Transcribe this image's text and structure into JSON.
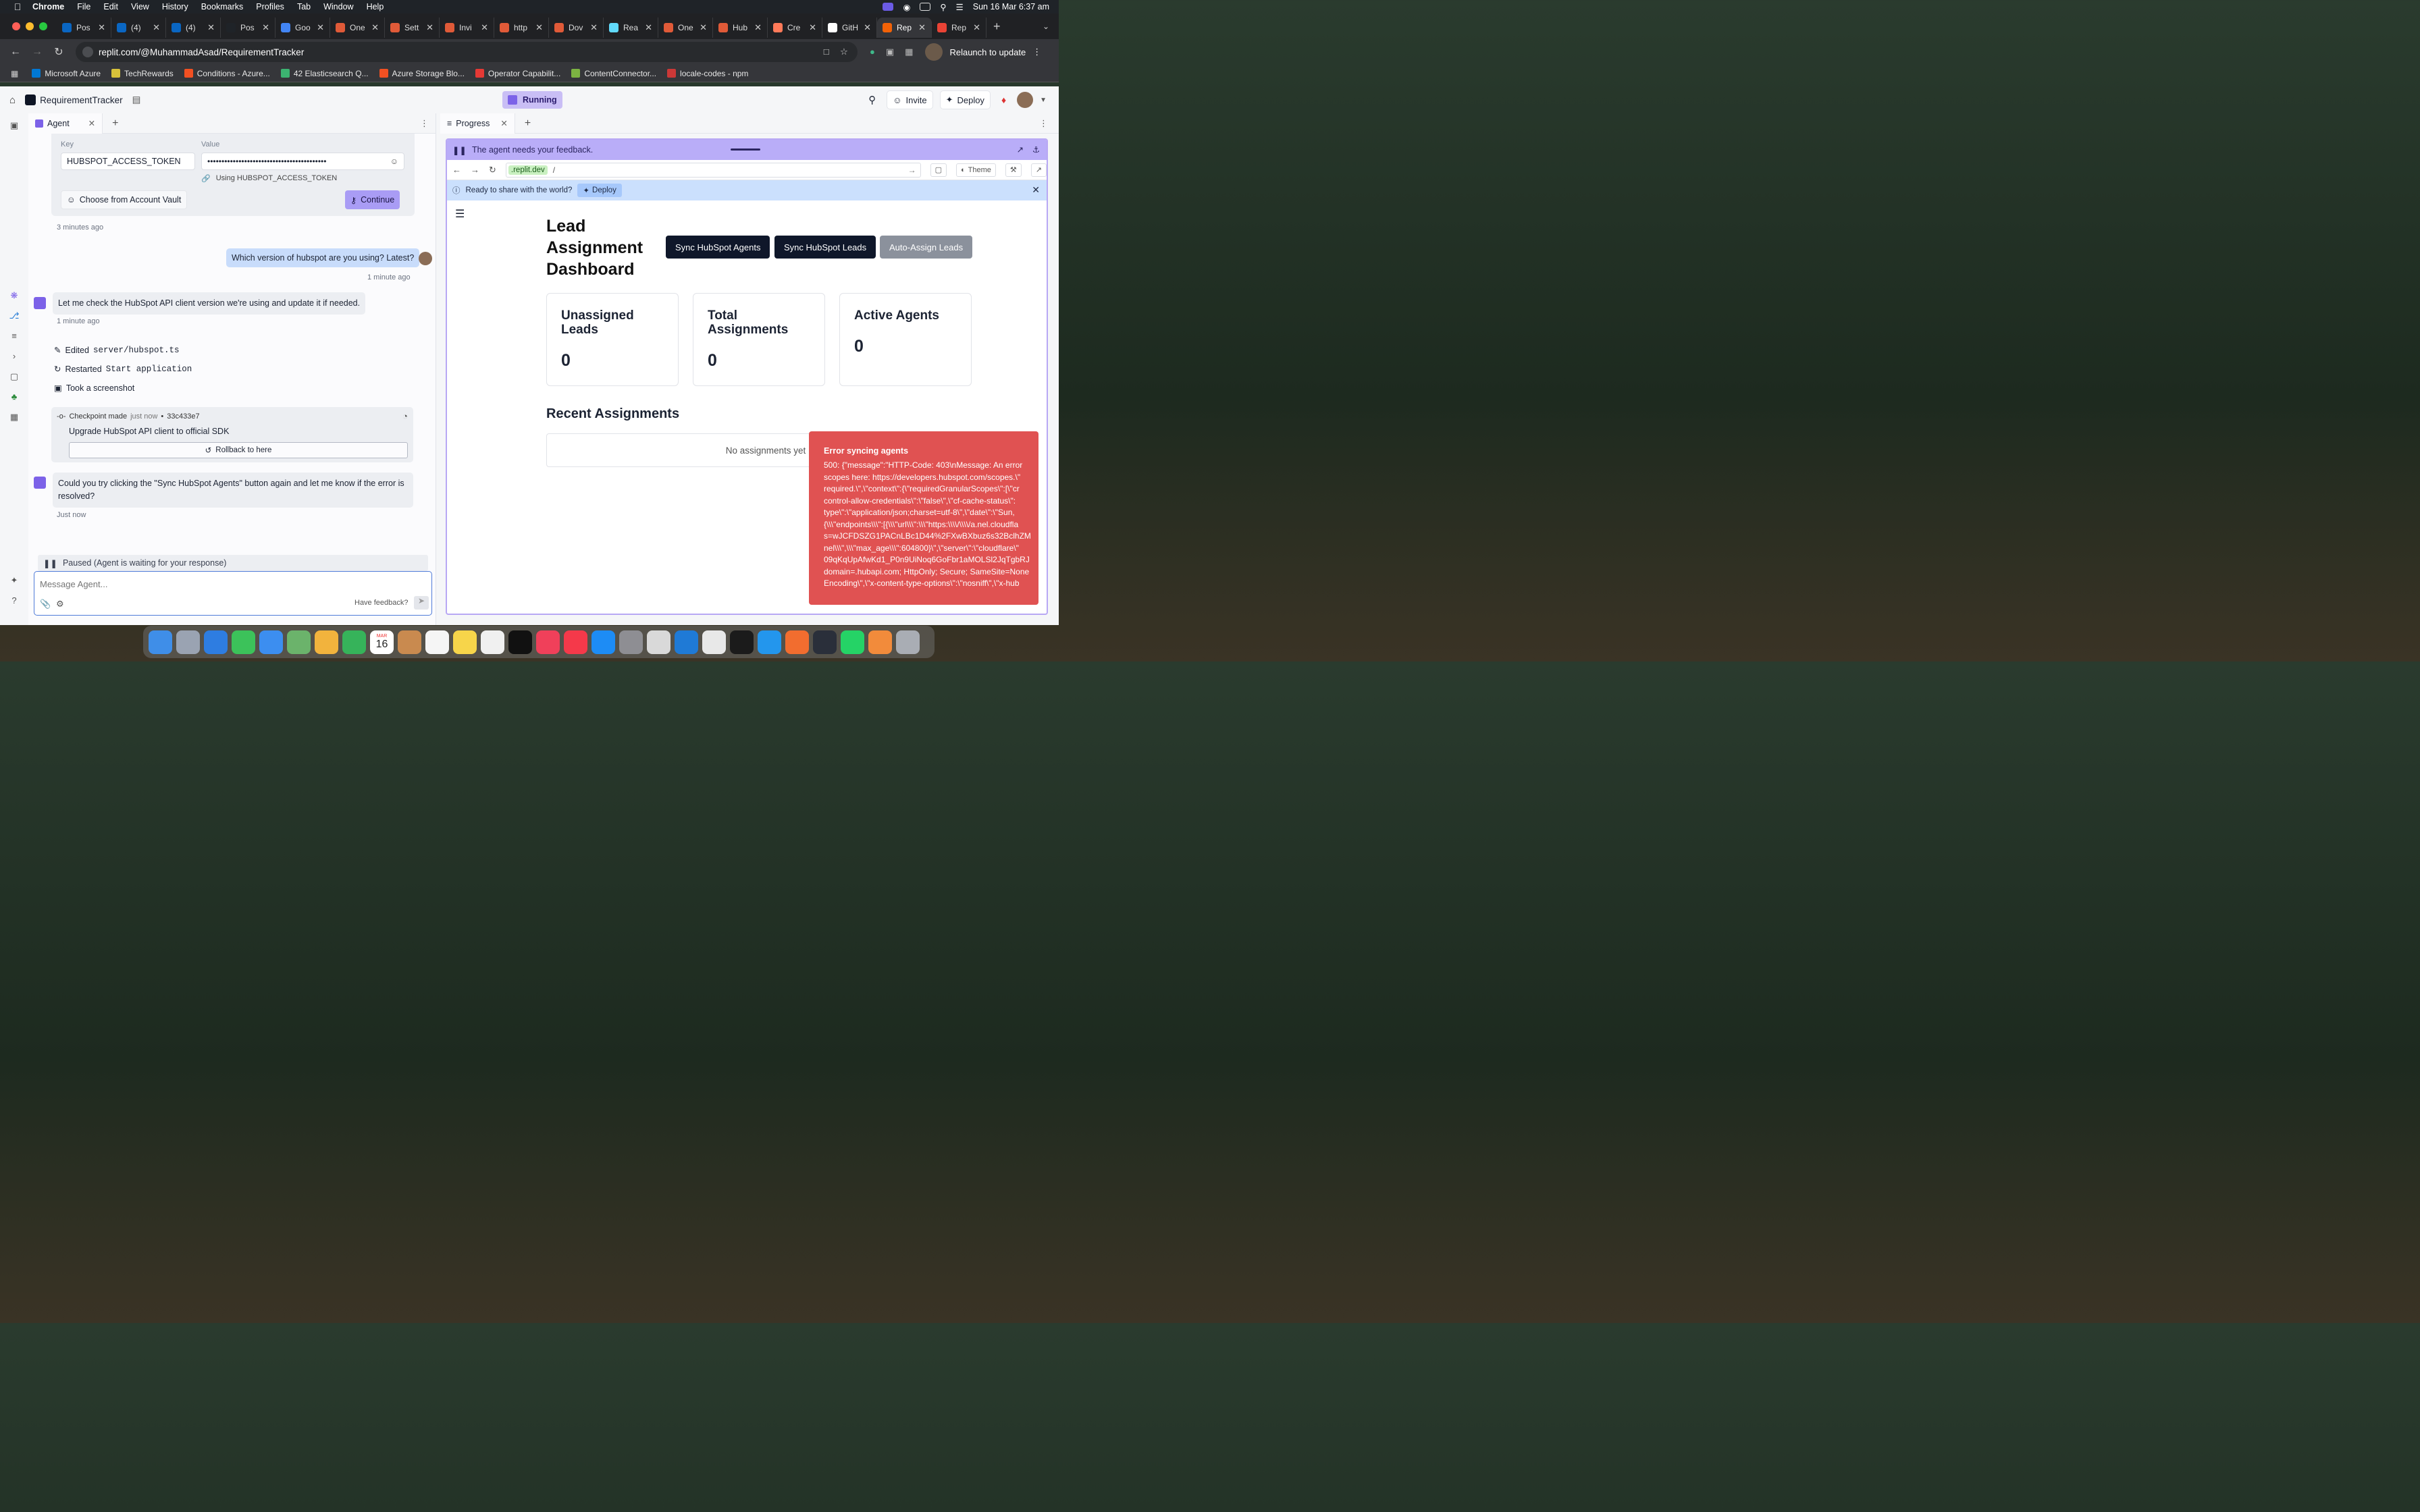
{
  "menubar": {
    "app": "Chrome",
    "items": [
      "File",
      "Edit",
      "View",
      "History",
      "Bookmarks",
      "Profiles",
      "Tab",
      "Window",
      "Help"
    ],
    "clock": "Sun 16 Mar  6:37 am"
  },
  "tabs": [
    {
      "label": "Pos",
      "color": "#0a66c2"
    },
    {
      "label": "(4)",
      "color": "#0a66c2"
    },
    {
      "label": "(4)",
      "color": "#0a66c2"
    },
    {
      "label": "Pos",
      "color": "#1f2328"
    },
    {
      "label": "Goo",
      "color": "#4285f4"
    },
    {
      "label": "One",
      "color": "#e05a38"
    },
    {
      "label": "Sett",
      "color": "#e05a38"
    },
    {
      "label": "Invi",
      "color": "#e05a38"
    },
    {
      "label": "http",
      "color": "#e05a38"
    },
    {
      "label": "Dov",
      "color": "#e05a38"
    },
    {
      "label": "Rea",
      "color": "#61dafb"
    },
    {
      "label": "One",
      "color": "#e05a38"
    },
    {
      "label": "Hub",
      "color": "#e05a38"
    },
    {
      "label": "Cre",
      "color": "#ff7a59"
    },
    {
      "label": "GitH",
      "color": "#ffffff"
    },
    {
      "label": "Rep",
      "color": "#f26207"
    },
    {
      "label": "Rep",
      "color": "#ea4335"
    }
  ],
  "address": {
    "url": "replit.com/@MuhammadAsad/RequirementTracker",
    "relaunch": "Relaunch to update"
  },
  "bookmarks": [
    {
      "label": "Microsoft Azure",
      "color": "#0078d4"
    },
    {
      "label": "TechRewards",
      "color": "#d8c23a"
    },
    {
      "label": "Conditions - Azure...",
      "color": "#f25022"
    },
    {
      "label": "42 Elasticsearch Q...",
      "color": "#3cb371"
    },
    {
      "label": "Azure Storage Blo...",
      "color": "#f25022"
    },
    {
      "label": "Operator Capabilit...",
      "color": "#e53935"
    },
    {
      "label": "ContentConnector...",
      "color": "#7cb342"
    },
    {
      "label": "locale-codes - npm",
      "color": "#cb3837"
    }
  ],
  "replit": {
    "project": "RequirementTracker",
    "status": "Running",
    "invite": "Invite",
    "deploy": "Deploy"
  },
  "agent": {
    "tab": "Agent",
    "vault": {
      "key_label": "Key",
      "value_label": "Value",
      "key": "HUBSPOT_ACCESS_TOKEN",
      "value": "••••••••••••••••••••••••••••••••••••••••••",
      "using": "Using HUBSPOT_ACCESS_TOKEN",
      "choose": "Choose from Account Vault",
      "continue": "Continue"
    },
    "time1": "3 minutes ago",
    "user_msg": "Which version of hubspot are you using? Latest?",
    "time2": "1 minute ago",
    "agent_msg1": "Let me check the HubSpot API client version we're using and update it if needed.",
    "time3": "1 minute ago",
    "actions": [
      {
        "verb": "Edited",
        "target": "server/hubspot.ts"
      },
      {
        "verb": "Restarted",
        "target": "Start application"
      },
      {
        "verb": "Took a screenshot",
        "target": ""
      }
    ],
    "checkpoint": {
      "label": "Checkpoint made",
      "when": "just now",
      "hash": "33c433e7",
      "title": "Upgrade HubSpot API client to official SDK",
      "rollback": "Rollback to here"
    },
    "agent_msg2": "Could you try clicking the \"Sync HubSpot Agents\" button again and let me know if the error is resolved?",
    "time4": "Just now",
    "paused": "Paused (Agent is waiting for your response)",
    "placeholder": "Message Agent...",
    "feedback": "Have feedback?"
  },
  "progress": {
    "tab": "Progress",
    "feedback_bar": "The agent needs your feedback.",
    "domain": ".replit.dev",
    "path": "/",
    "theme": "Theme",
    "share": "Ready to share with the world?",
    "deploy": "Deploy"
  },
  "dashboard": {
    "title": "Lead Assignment Dashboard",
    "buttons": [
      "Sync HubSpot Agents",
      "Sync HubSpot Leads",
      "Auto-Assign Leads"
    ],
    "cards": [
      {
        "title": "Unassigned Leads",
        "value": "0"
      },
      {
        "title": "Total Assignments",
        "value": "0"
      },
      {
        "title": "Active Agents",
        "value": "0"
      }
    ],
    "recent": "Recent Assignments",
    "empty": "No assignments yet",
    "toast_title": "Error syncing agents",
    "toast_body": "500: {\"message\":\"HTTP-Code: 403\\nMessage: An error\nscopes here: https://developers.hubspot.com/scopes.\\\"\nrequired.\\\",\\\"context\\\":{\\\"requiredGranularScopes\\\":[\\\"cr\ncontrol-allow-credentials\\\":\\\"false\\\",\\\"cf-cache-status\\\":\ntype\\\":\\\"application/json;charset=utf-8\\\",\\\"date\\\":\\\"Sun, \n{\\\\\\\"endpoints\\\\\\\":[{\\\\\\\"url\\\\\\\":\\\\\\\"https:\\\\\\\\/\\\\\\\\/a.nel.cloudfla\ns=wJCFDSZG1PACnLBc1D44%2FXwBXbuz6s32BclhZM\nnel\\\\\\\",\\\\\\\"max_age\\\\\\\":604800}\\\",\\\"server\\\":\\\"cloudflare\\\"\n09qKqUpAfwKd1_P0n9UiNoq6GoFbr1aMOLSl2JqTgbRJ\ndomain=.hubapi.com; HttpOnly; Secure; SameSite=None\nEncoding\\\",\\\"x-content-type-options\\\":\\\"nosniff\\\",\\\"x-hub"
  },
  "dock": {
    "calendar_day": "16",
    "calendar_month": "MAR"
  }
}
